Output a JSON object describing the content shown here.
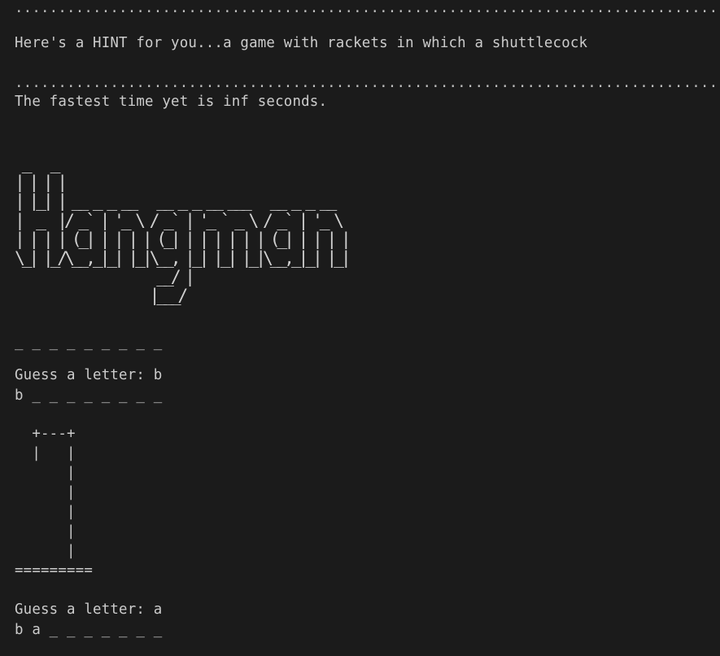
{
  "terminal": {
    "background": "#1b1b1b",
    "foreground": "#cccccc",
    "separator_top": "...............................................................................................",
    "hint_line": "Here's a HINT for you...a game with rackets in which a shuttlecock",
    "separator_mid": "...............................................................................................",
    "fastest_line": "The fastest time yet is inf seconds.",
    "banner_art": " _   _                                         \n| | | |                                        \n| |_| | __ _ _ __   __ _ _ __ ___   __ _ _ __  \n|  _  |/ _` | '_ \\ / _` | '_ ` _ \\ / _` | '_ \\ \n| | | | (_| | | | | (_| | | | | | | (_| | | | |\n\\_| |_/\\__,_|_| |_|\\__, |_| |_| |_|\\__,_|_| |_|\n                    __/ |                      \n                   |___/                       ",
    "word_progress_initial": "_ _ _ _ _ _ _ _ _",
    "guess_1_prompt": "Guess a letter: b",
    "guess_1_progress": "b _ _ _ _ _ _ _ _",
    "gallows_art": "  +---+\n  |   |\n      |\n      |\n      |\n      |\n      |\n=========",
    "guess_2_prompt": "Guess a letter: a",
    "guess_2_progress": "b a _ _ _ _ _ _ _"
  }
}
